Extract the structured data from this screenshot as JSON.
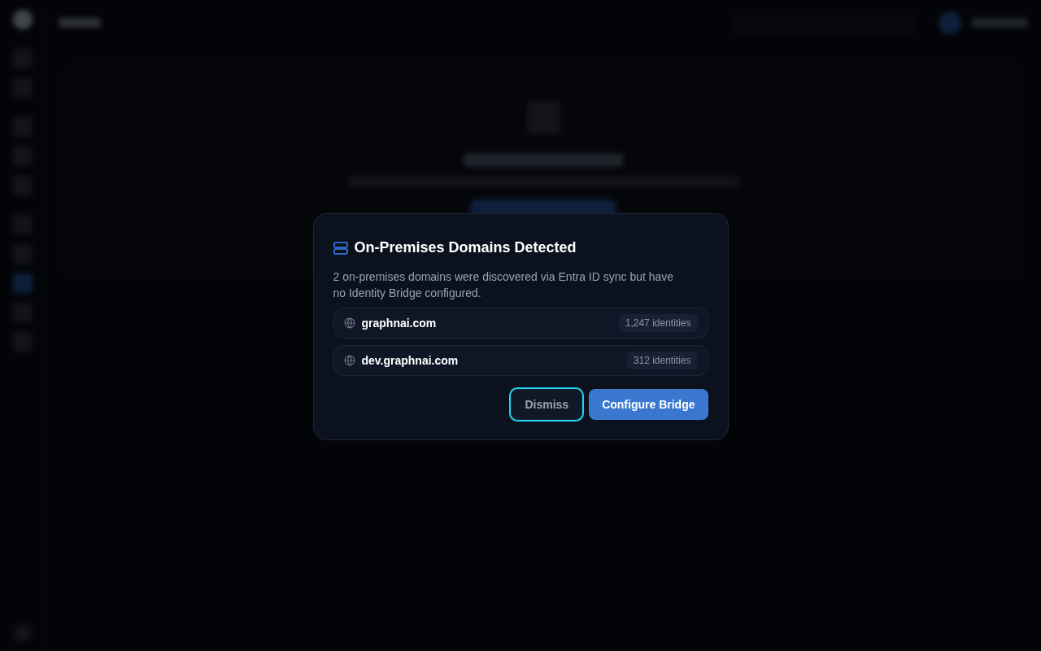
{
  "sidebar": {
    "items": [
      {
        "selected": false
      },
      {
        "selected": false
      },
      {
        "selected": false
      },
      {
        "selected": false
      },
      {
        "selected": false
      },
      {
        "selected": false
      },
      {
        "selected": false
      },
      {
        "selected": true
      },
      {
        "selected": false
      },
      {
        "selected": false
      }
    ]
  },
  "dialog": {
    "title": "On-Premises Domains Detected",
    "message": "2 on-premises domains were discovered via Entra ID sync but have no Identity Bridge configured.",
    "domains": [
      {
        "name": "graphnai.com",
        "count": "1,247 identities"
      },
      {
        "name": "dev.graphnai.com",
        "count": "312 identities"
      }
    ],
    "buttons": [
      {
        "kind": "secondary",
        "label": "Dismiss",
        "focused": true
      },
      {
        "kind": "primary",
        "label": "Configure Bridge",
        "focused": false
      }
    ]
  }
}
